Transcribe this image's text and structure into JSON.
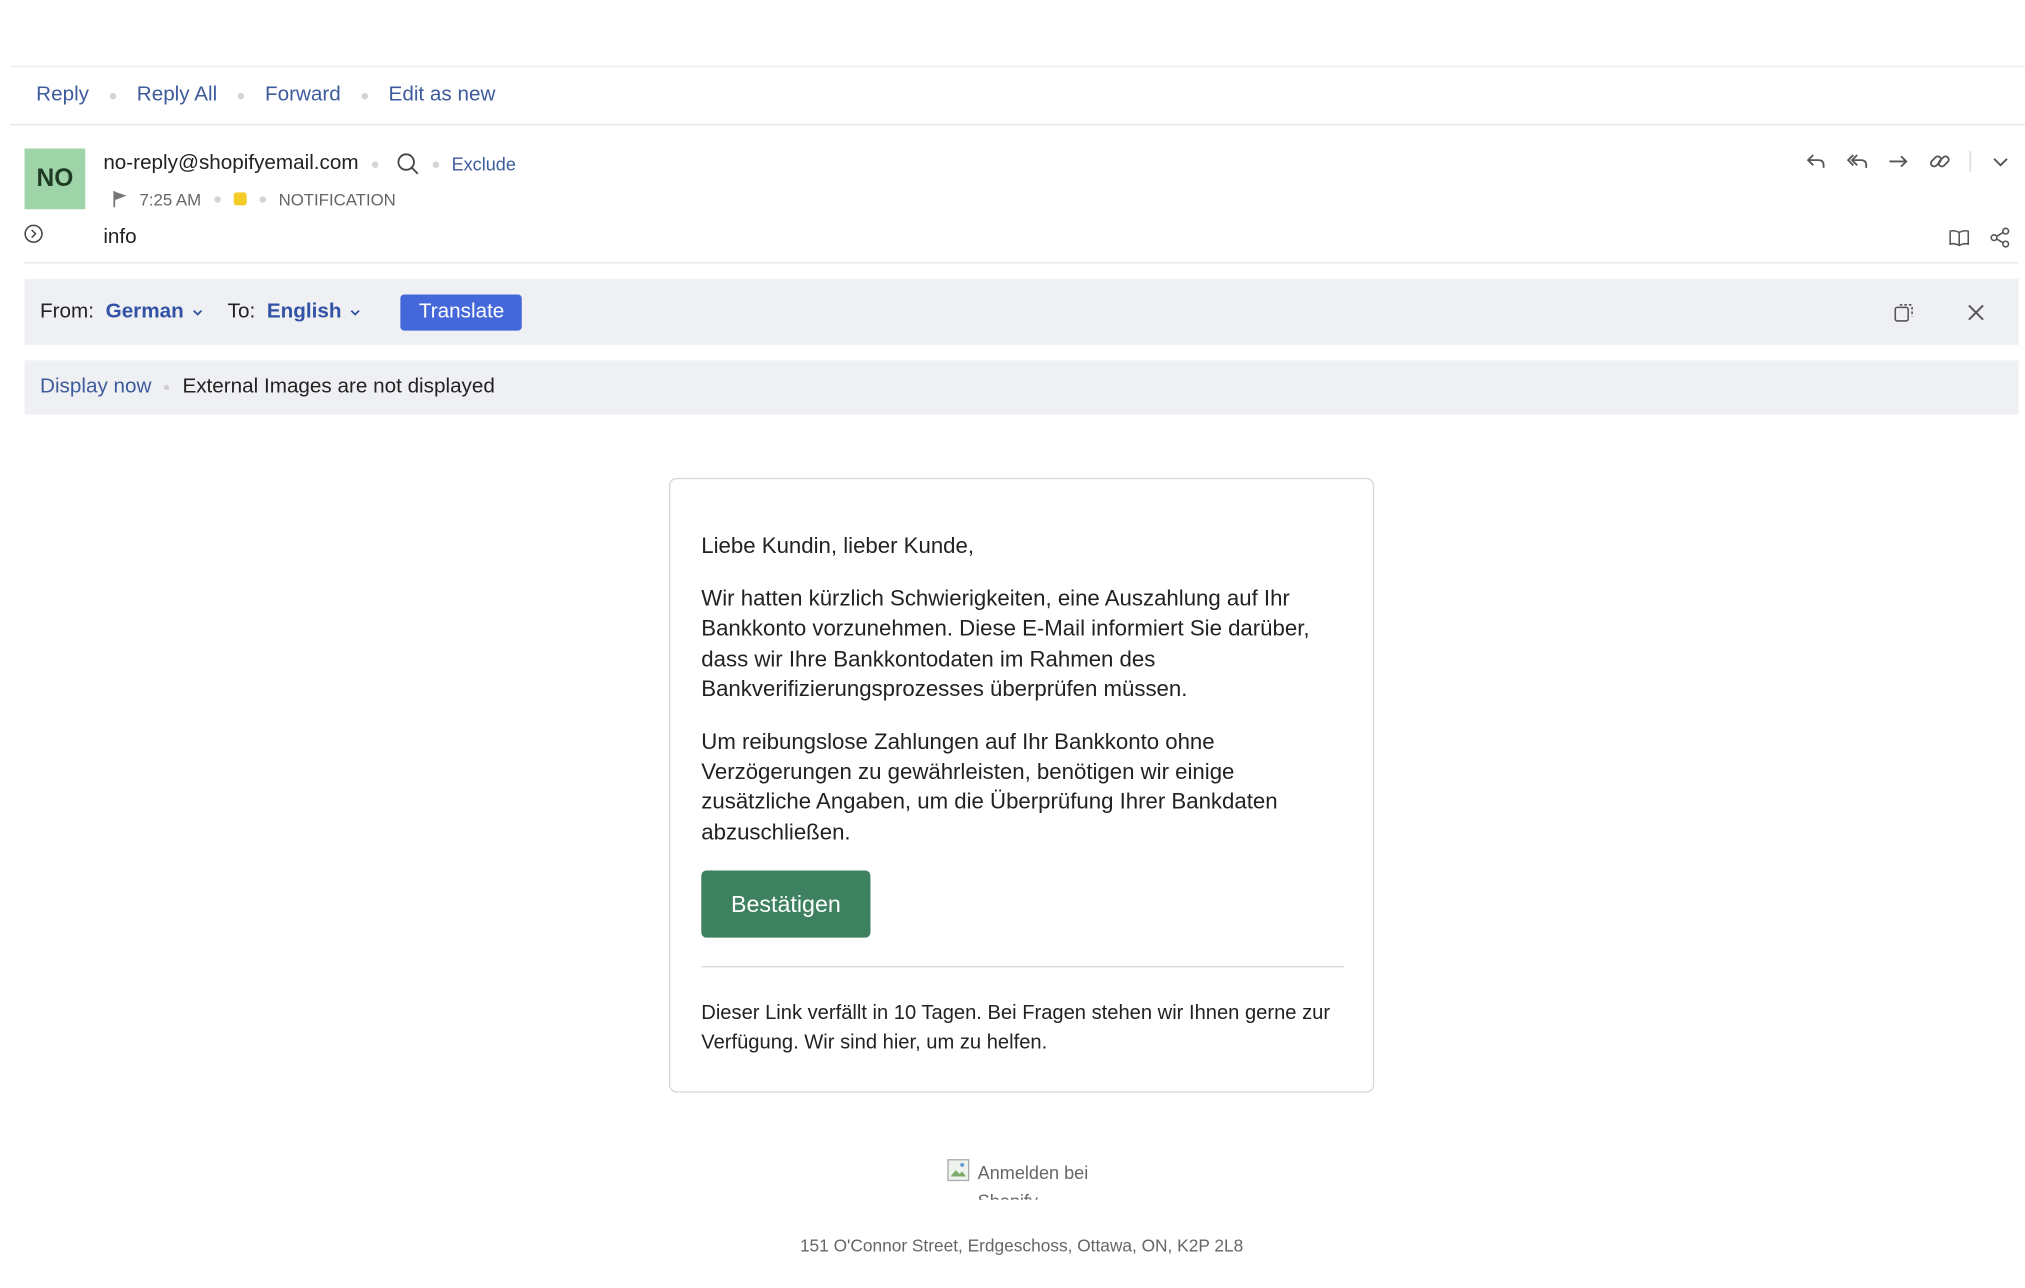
{
  "actions": {
    "reply": "Reply",
    "reply_all": "Reply All",
    "forward": "Forward",
    "edit_as_new": "Edit as new"
  },
  "header": {
    "avatar_initials": "NO",
    "avatar_color": "#9fd3a8",
    "sender": "no-reply@shopifyemail.com",
    "exclude": "Exclude",
    "time": "7:25 AM",
    "tag_color": "#f4cd2a",
    "category": "NOTIFICATION",
    "subject": "info",
    "icons": [
      "reply-icon",
      "reply-all-icon",
      "forward-icon",
      "link-icon",
      "chevron-down-icon",
      "reader-icon",
      "share-icon"
    ]
  },
  "translate": {
    "from_label": "From:",
    "from_lang": "German",
    "to_label": "To:",
    "to_lang": "English",
    "button": "Translate",
    "accent": "#4468d9"
  },
  "images_notice": {
    "display_now": "Display now",
    "message": "External Images are not displayed"
  },
  "email": {
    "greeting": "Liebe Kundin, lieber Kunde,",
    "para1": "Wir hatten kürzlich Schwierigkeiten, eine Auszahlung auf Ihr Bankkonto vorzunehmen. Diese E-Mail informiert Sie darüber, dass wir Ihre Bankkontodaten im Rahmen des Bankverifizierungsprozesses überprüfen müssen.",
    "para2": "Um reibungslose Zahlungen auf Ihr Bankkonto ohne Verzögerungen zu gewährleisten, benötigen wir einige zusätzliche Angaben, um die Überprüfung Ihrer Bankdaten abzuschließen.",
    "button": "Bestätigen",
    "button_color": "#3e8160",
    "footer_note": "Dieser Link verfällt in 10 Tagen. Bei Fragen stehen wir Ihnen gerne zur Verfügung. Wir sind hier, um zu helfen.",
    "image_alt": "Anmelden bei Shopify",
    "address": "151 O'Connor Street, Erdgeschoss, Ottawa, ON, K2P 2L8"
  }
}
